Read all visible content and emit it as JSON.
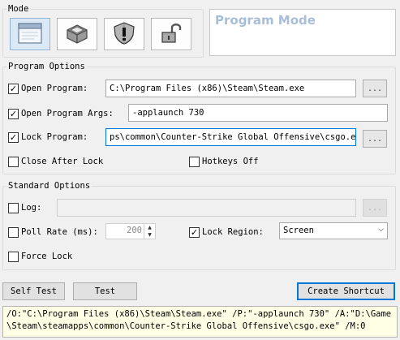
{
  "mode": {
    "title": "Mode",
    "buttons": [
      {
        "icon": "window-icon",
        "selected": true
      },
      {
        "icon": "keyboard-key-icon",
        "selected": false
      },
      {
        "icon": "warning-shield-icon",
        "selected": false
      },
      {
        "icon": "unlocked-padlock-icon",
        "selected": false
      }
    ],
    "display_title": "Program Mode"
  },
  "program_options": {
    "title": "Program Options",
    "open_program": {
      "label": "Open Program:",
      "checked": true,
      "value": "C:\\Program Files (x86)\\Steam\\Steam.exe",
      "browse": "..."
    },
    "open_program_args": {
      "label": "Open Program Args:",
      "checked": true,
      "value": "-applaunch 730"
    },
    "lock_program": {
      "label": "Lock Program:",
      "checked": true,
      "value": "ps\\common\\Counter-Strike Global Offensive\\csgo.exe",
      "browse": "..."
    },
    "close_after_lock": {
      "label": "Close After Lock",
      "checked": false
    },
    "hotkeys_off": {
      "label": "Hotkeys Off",
      "checked": false
    }
  },
  "standard_options": {
    "title": "Standard Options",
    "log": {
      "label": "Log:",
      "checked": false,
      "value": "",
      "browse": "..."
    },
    "poll_rate": {
      "label": "Poll Rate (ms):",
      "checked": false,
      "value": "200"
    },
    "lock_region": {
      "label": "Lock Region:",
      "checked": true,
      "selected": "Screen"
    },
    "force_lock": {
      "label": "Force Lock",
      "checked": false
    }
  },
  "buttons": {
    "self_test": "Self Test",
    "test": "Test",
    "create_shortcut": "Create Shortcut"
  },
  "command_line": {
    "line1": "/O:\"C:\\Program Files (x86)\\Steam\\Steam.exe\" /P:\"-applaunch 730\" /A:\"D:\\Game",
    "line2": "\\Steam\\steamapps\\common\\Counter-Strike Global Offensive\\csgo.exe\" /M:0"
  }
}
